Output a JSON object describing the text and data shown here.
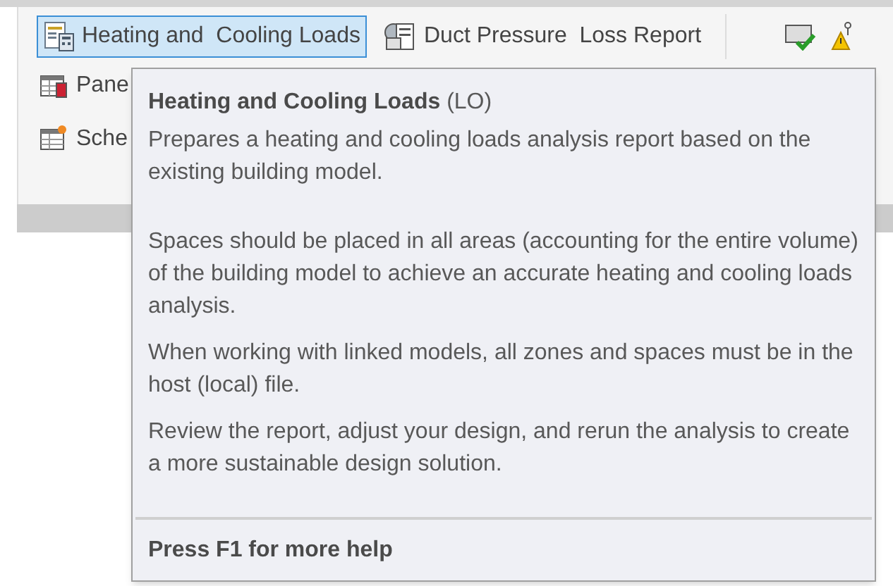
{
  "ribbon": {
    "large_buttons": [
      {
        "label": "Heating and  Cooling Loads",
        "selected": true
      },
      {
        "label": "Duct Pressure  Loss Report",
        "selected": false
      }
    ],
    "small_buttons": [
      {
        "label": "Pane"
      },
      {
        "label": "Sche"
      }
    ]
  },
  "tooltip": {
    "title": "Heating and Cooling Loads",
    "shortcut": "(LO)",
    "description": "Prepares a heating and cooling loads analysis report based on the existing building model.",
    "paragraphs": [
      "Spaces should be placed in all areas (accounting for the entire volume) of the building model to achieve an accurate heating and cooling loads analysis.",
      "When working with linked models, all zones and spaces must be in the host (local) file.",
      "Review the report, adjust your design, and rerun the analysis to create a more sustainable design solution."
    ],
    "footer": "Press F1 for more help"
  }
}
